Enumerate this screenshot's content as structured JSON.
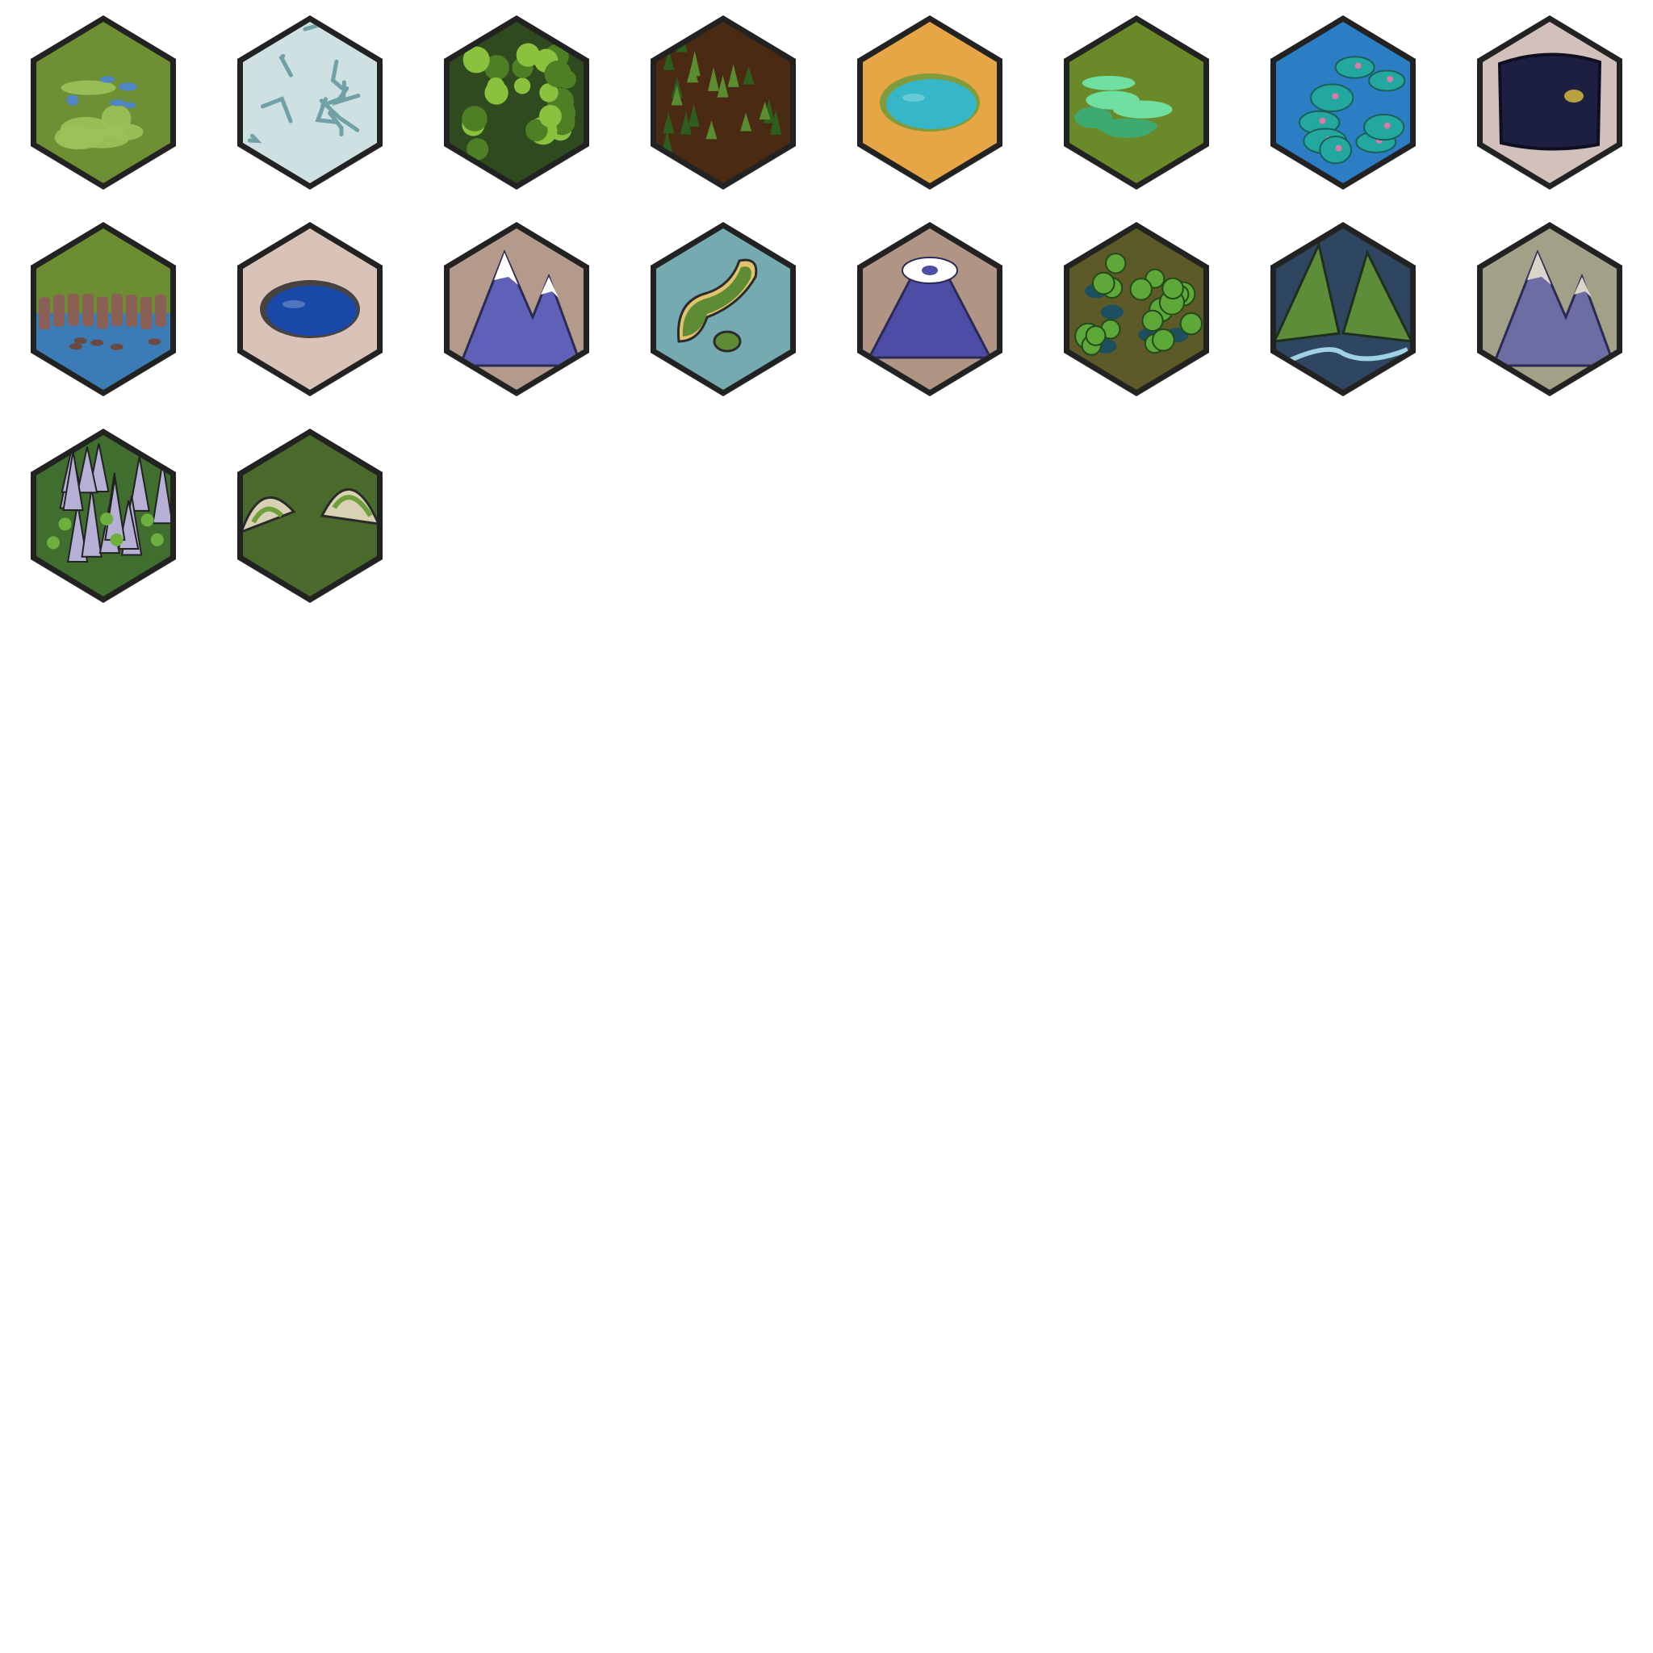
{
  "sheet": {
    "columns": 8,
    "background": "#ffffff",
    "border_color": "#222222"
  },
  "tiles": [
    {
      "icon": "marsh-grassland-tile",
      "base": "#6f8f34",
      "accent": "#9cc15a",
      "detail": "#4f86c4",
      "motif": "marsh"
    },
    {
      "icon": "ice-floes-tile",
      "base": "#cfe0e3",
      "accent": "#f2f6f6",
      "detail": "#6fa1a6",
      "motif": "cracks"
    },
    {
      "icon": "dense-jungle-tile",
      "base": "#2f4a1e",
      "accent": "#8ac23d",
      "detail": "#4f7f25",
      "motif": "bushes"
    },
    {
      "icon": "pine-forest-tile",
      "base": "#4a2a12",
      "accent": "#5a8d2f",
      "detail": "#2d5e1e",
      "motif": "pines"
    },
    {
      "icon": "desert-oasis-tile",
      "base": "#e6a646",
      "accent": "#35b7c9",
      "detail": "#6e9a3a",
      "motif": "lake"
    },
    {
      "icon": "toxic-swamp-tile",
      "base": "#6a8a2a",
      "accent": "#6fe0a0",
      "detail": "#3faa6f",
      "motif": "blobs"
    },
    {
      "icon": "coral-reef-tile",
      "base": "#2c7ec4",
      "accent": "#22a89e",
      "detail": "#d97aa7",
      "motif": "reef"
    },
    {
      "icon": "dark-cave-pool-tile",
      "base": "#d2c0bb",
      "accent": "#1c1f3f",
      "detail": "#b8a23f",
      "motif": "pool"
    },
    {
      "icon": "coastal-cliffs-tile",
      "base": "#6d8d32",
      "accent": "#8a5f55",
      "detail": "#3b7bb6",
      "motif": "cliffs"
    },
    {
      "icon": "crater-lake-tile",
      "base": "#d9c3b8",
      "accent": "#1849a8",
      "detail": "#2b2b2b",
      "motif": "lake"
    },
    {
      "icon": "snowy-mountain-tile",
      "base": "#b39a8a",
      "accent": "#5f60b8",
      "detail": "#ffffff",
      "motif": "peaks"
    },
    {
      "icon": "small-islands-tile",
      "base": "#74aab0",
      "accent": "#5d8c34",
      "detail": "#e2c26c",
      "motif": "islands"
    },
    {
      "icon": "volcano-crater-tile",
      "base": "#b09484",
      "accent": "#4e4da6",
      "detail": "#ffffff",
      "motif": "volcano"
    },
    {
      "icon": "rainforest-pools-tile",
      "base": "#5e5a28",
      "accent": "#5ea83a",
      "detail": "#1e4f5f",
      "motif": "trees"
    },
    {
      "icon": "river-valley-tile",
      "base": "#2f4660",
      "accent": "#5d8d39",
      "detail": "#9fd3e4",
      "motif": "valley"
    },
    {
      "icon": "rocky-highlands-tile",
      "base": "#a2a187",
      "accent": "#6b6da3",
      "detail": "#d8d6c8",
      "motif": "peaks"
    },
    {
      "icon": "karst-spires-tile",
      "base": "#3f6e2e",
      "accent": "#b6b0d6",
      "detail": "#6eb03e",
      "motif": "spires"
    },
    {
      "icon": "grassy-hills-tile",
      "base": "#4a6a2c",
      "accent": "#d8d1b4",
      "detail": "#6d9f3a",
      "motif": "hills"
    }
  ]
}
